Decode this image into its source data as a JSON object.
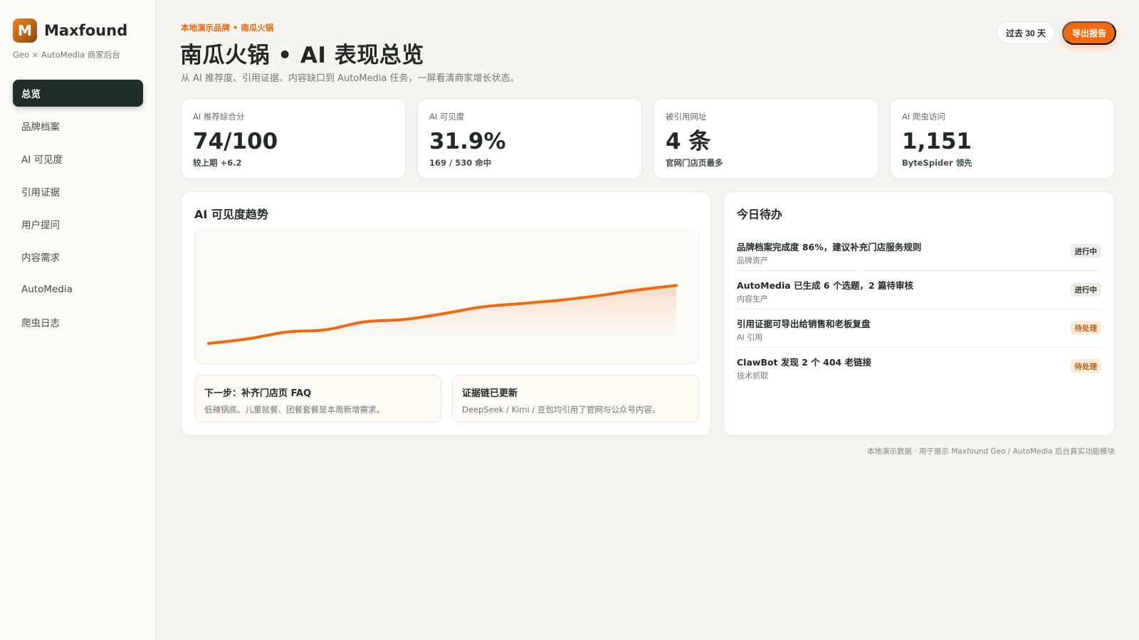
{
  "brand": {
    "logo_letter": "M",
    "name": "Maxfound",
    "subtitle": "Geo × AutoMedia 商家后台"
  },
  "sidebar": {
    "items": [
      {
        "label": "总览",
        "active": true
      },
      {
        "label": "品牌档案"
      },
      {
        "label": "AI 可见度"
      },
      {
        "label": "引用证据"
      },
      {
        "label": "用户提问"
      },
      {
        "label": "内容需求"
      },
      {
        "label": "AutoMedia"
      },
      {
        "label": "爬虫日志"
      }
    ]
  },
  "header": {
    "eyebrow": "本地演示品牌 • 南瓜火锅",
    "title": "南瓜火锅 • AI 表现总览",
    "description": "从 AI 推荐度、引用证据、内容缺口到 AutoMedia 任务，一屏看清商家增长状态。",
    "range_label": "过去 30 天",
    "export_label": "导出报告"
  },
  "kpis": [
    {
      "label": "AI 推荐综合分",
      "value": "74/100",
      "note": "较上期 +6.2"
    },
    {
      "label": "AI 可见度",
      "value": "31.9%",
      "note": "169 / 530 命中"
    },
    {
      "label": "被引用网址",
      "value": "4 条",
      "note": "官网门店页最多"
    },
    {
      "label": "AI 爬虫访问",
      "value": "1,151",
      "note": "ByteSpider 领先"
    }
  ],
  "trend": {
    "title": "AI 可见度趋势",
    "notes": [
      {
        "title": "下一步：补齐门店页 FAQ",
        "text": "低辣锅底、儿童就餐、团餐套餐是本周新增需求。"
      },
      {
        "title": "证据链已更新",
        "text": "DeepSeek / Kimi / 豆包均引用了官网与公众号内容。"
      }
    ]
  },
  "chart_data": {
    "type": "area",
    "title": "AI 可见度趋势",
    "x": [
      1,
      2,
      3,
      4,
      5,
      6,
      7,
      8,
      9,
      10,
      11,
      12,
      13
    ],
    "values": [
      10,
      14,
      20,
      22,
      29,
      31,
      36,
      42,
      45,
      48,
      52,
      57,
      61
    ],
    "ylim": [
      0,
      100
    ],
    "grid": false,
    "line_color": "#f0690f"
  },
  "todo": {
    "title": "今日待办",
    "items": [
      {
        "title": "品牌档案完成度 86%，建议补充门店服务规则",
        "sub": "品牌资产",
        "status": "进行中",
        "kind": "progress"
      },
      {
        "title": "AutoMedia 已生成 6 个选题，2 篇待审核",
        "sub": "内容生产",
        "status": "进行中",
        "kind": "progress"
      },
      {
        "title": "引用证据可导出给销售和老板复盘",
        "sub": "AI 引用",
        "status": "待处理",
        "kind": "pending"
      },
      {
        "title": "ClawBot 发现 2 个 404 老链接",
        "sub": "技术抓取",
        "status": "待处理",
        "kind": "pending"
      }
    ]
  },
  "footer": "本地演示数据 · 用于展示 Maxfound Geo / AutoMedia 后台真实功能模块"
}
